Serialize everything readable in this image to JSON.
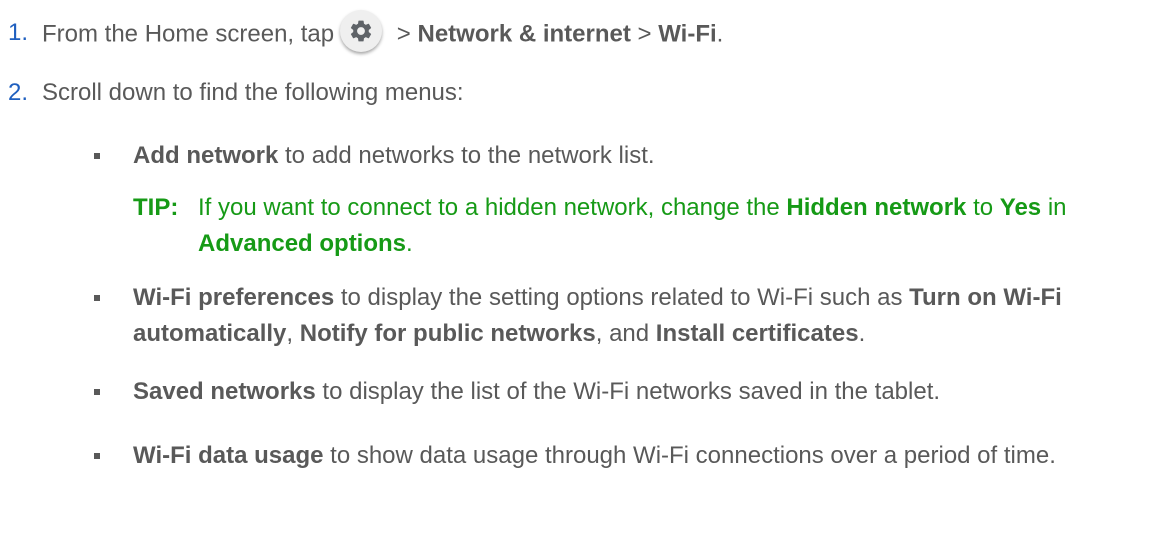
{
  "steps": [
    {
      "number": "1.",
      "prefix": "From the Home screen, tap",
      "icon": "settings-gear-icon",
      "sep1": " > ",
      "bold1": "Network & internet",
      "sep2": " > ",
      "bold2": "Wi-Fi",
      "end": "."
    },
    {
      "number": "2.",
      "text": "Scroll down to find the following menus:"
    }
  ],
  "items": [
    {
      "bold": "Add network",
      "text": " to add networks to the network list."
    },
    {
      "bold": "Wi-Fi preferences",
      "text1": " to display the setting options related to Wi-Fi such as ",
      "bold2": "Turn on Wi-Fi automatically",
      "text2": ", ",
      "bold3": "Notify for public networks",
      "text3": ", and ",
      "bold4": "Install certificates",
      "text4": "."
    },
    {
      "bold": "Saved networks",
      "text": " to display the list of the Wi-Fi networks saved in the tablet."
    },
    {
      "bold": "Wi-Fi data usage",
      "text": " to show data usage through Wi-Fi connections over a period of time."
    }
  ],
  "tip": {
    "label": "TIP:",
    "text1": "If you want to connect to a hidden network, change the ",
    "bold1": "Hidden network",
    "text2": " to ",
    "bold2": "Yes",
    "text3": " in ",
    "bold3": "Advanced options",
    "text4": "."
  },
  "colors": {
    "body_text": "#595959",
    "number": "#1f5fbf",
    "tip": "#169a16",
    "gear": "#5f6368"
  }
}
